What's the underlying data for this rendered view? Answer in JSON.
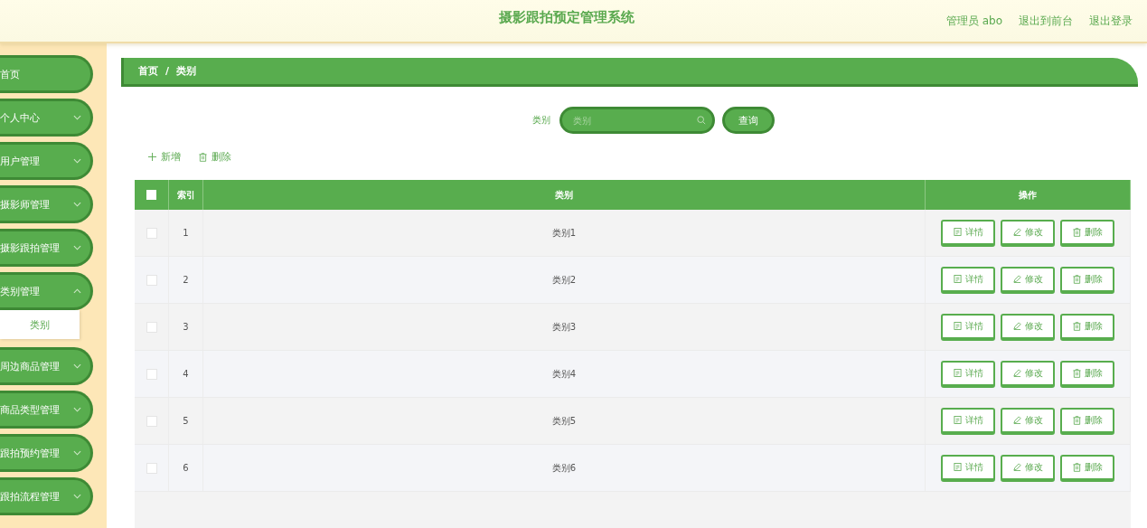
{
  "header": {
    "title": "摄影跟拍预定管理系统",
    "links": [
      "管理员 abo",
      "退出到前台",
      "退出登录"
    ]
  },
  "sidebar": {
    "items": [
      {
        "label": "首页",
        "has_arrow": false
      },
      {
        "label": "个人中心",
        "has_arrow": true,
        "expanded": false
      },
      {
        "label": "用户管理",
        "has_arrow": true,
        "expanded": false
      },
      {
        "label": "摄影师管理",
        "has_arrow": true,
        "expanded": false
      },
      {
        "label": "摄影跟拍管理",
        "has_arrow": true,
        "expanded": false
      },
      {
        "label": "类别管理",
        "has_arrow": true,
        "expanded": true,
        "children": [
          {
            "label": "类别"
          }
        ]
      },
      {
        "label": "周边商品管理",
        "has_arrow": true,
        "expanded": false
      },
      {
        "label": "商品类型管理",
        "has_arrow": true,
        "expanded": false
      },
      {
        "label": "跟拍预约管理",
        "has_arrow": true,
        "expanded": false
      },
      {
        "label": "跟拍流程管理",
        "has_arrow": true,
        "expanded": false
      }
    ]
  },
  "breadcrumb": [
    "首页",
    "/",
    "类别"
  ],
  "search": {
    "label": "类别",
    "placeholder": "类别",
    "button": "查询"
  },
  "actions": [
    "新增",
    "删除"
  ],
  "table": {
    "header_checked": false,
    "columns": [
      "索引",
      "类别",
      "操作"
    ],
    "rows": [
      {
        "checked": false,
        "index": "1",
        "category": "类别1",
        "buttons": [
          "详情",
          "修改",
          "删除"
        ]
      },
      {
        "checked": false,
        "index": "2",
        "category": "类别2",
        "buttons": [
          "详情",
          "修改",
          "删除"
        ]
      },
      {
        "checked": false,
        "index": "3",
        "category": "类别3",
        "buttons": [
          "详情",
          "修改",
          "删除"
        ]
      },
      {
        "checked": false,
        "index": "4",
        "category": "类别4",
        "buttons": [
          "详情",
          "修改",
          "删除"
        ]
      },
      {
        "checked": false,
        "index": "5",
        "category": "类别5",
        "buttons": [
          "详情",
          "修改",
          "删除"
        ]
      },
      {
        "checked": false,
        "index": "6",
        "category": "类别6",
        "buttons": [
          "详情",
          "修改",
          "删除"
        ]
      }
    ]
  }
}
